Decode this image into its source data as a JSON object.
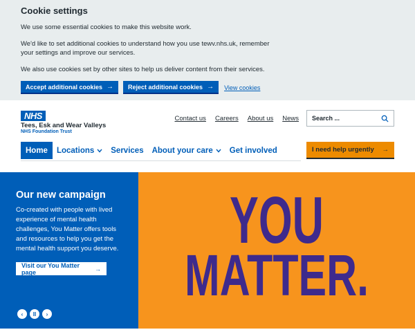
{
  "cookie": {
    "title": "Cookie settings",
    "p1": "We use some essential cookies to make this website work.",
    "p2": "We'd like to set additional cookies to understand how you use tewv.nhs.uk, remember your settings and improve our services.",
    "p3": "We also use cookies set by other sites to help us deliver content from their services.",
    "accept_label": "Accept additional cookies",
    "reject_label": "Reject additional cookies",
    "view_label": "View cookies",
    "arrow": "→"
  },
  "header": {
    "nhs": "NHS",
    "org_name": "Tees, Esk and Wear Valleys",
    "org_sub": "NHS Foundation Trust",
    "top_links": [
      "Contact us",
      "Careers",
      "About us",
      "News"
    ],
    "search_placeholder": "Search ...",
    "urgent_label": "I need help urgently",
    "urgent_arrow": "→"
  },
  "nav": {
    "home": "Home",
    "locations": "Locations",
    "services": "Services",
    "about_care": "About your care",
    "get_involved": "Get involved",
    "chevron": "⌄"
  },
  "hero": {
    "title": "Our new campaign",
    "body": "Co-created with people with lived experience of mental health challenges, You Matter offers tools and resources to help you get the mental health support you deserve.",
    "button_label": "Visit our You Matter page",
    "button_arrow": "→",
    "prev": "‹",
    "pause": "II",
    "next": "›",
    "art_line1": "YOU",
    "art_line2": "MATTER."
  },
  "colors": {
    "nhs_blue": "#005eb8",
    "orange": "#f7941d",
    "urgent": "#ed8b00",
    "purple": "#3e2a8c"
  }
}
